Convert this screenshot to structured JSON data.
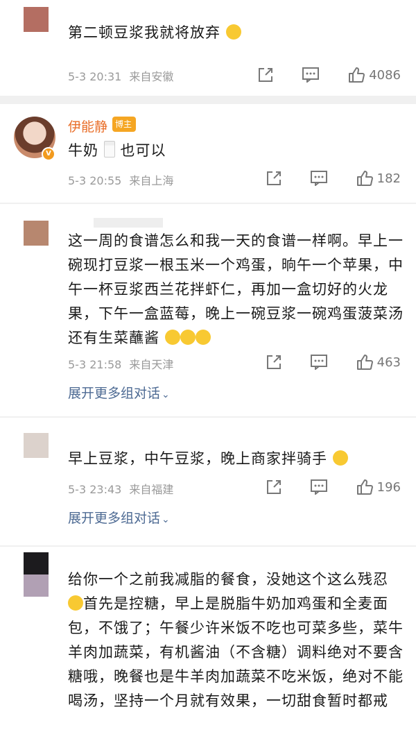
{
  "colors": {
    "username": "#e96f2a",
    "badge": "#f5a623",
    "link": "#4d6a93",
    "meta": "#9a9a9a",
    "divider": "#f0f0f0"
  },
  "comments": [
    {
      "text": "第二顿豆浆我就将放弃",
      "emoji": "grinning-sweat-emoji",
      "time": "5-3 20:31",
      "location": "来自安徽",
      "likes": "4086"
    },
    {
      "username": "伊能静",
      "badge": "博主",
      "text": "牛奶",
      "text_after": "也可以",
      "time": "5-3 20:55",
      "location": "来自上海",
      "likes": "182"
    },
    {
      "text": "这一周的食谱怎么和我一天的食谱一样啊。早上一碗现打豆浆一根玉米一个鸡蛋，晌午一个苹果，中午一杯豆浆西兰花拌虾仁，再加一盒切好的火龙果，下午一盒蓝莓，晚上一碗豆浆一碗鸡蛋菠菜汤还有生菜蘸酱",
      "time": "5-3 21:58",
      "location": "来自天津",
      "likes": "463",
      "more": "展开更多组对话"
    },
    {
      "text": "早上豆浆，中午豆浆，晚上商家拌骑手",
      "time": "5-3 23:43",
      "location": "来自福建",
      "likes": "196",
      "more": "展开更多组对话"
    },
    {
      "text_before": "给你一个之前我减脂的餐食，没她这个这么残忍",
      "text": "首先是控糖，早上是脱脂牛奶加鸡蛋和全麦面包，不饿了；午餐少许米饭不吃也可菜多些，菜牛羊肉加蔬菜，有机酱油（不含糖）调料绝对不要含糖哦，晚餐也是牛羊肉加蔬菜不吃米饭，绝对不能喝汤，坚持一个月就有效果，一切甜食暂时都戒"
    }
  ],
  "icons": {
    "share": "share-icon",
    "comment": "comment-icon",
    "like": "like-icon"
  }
}
